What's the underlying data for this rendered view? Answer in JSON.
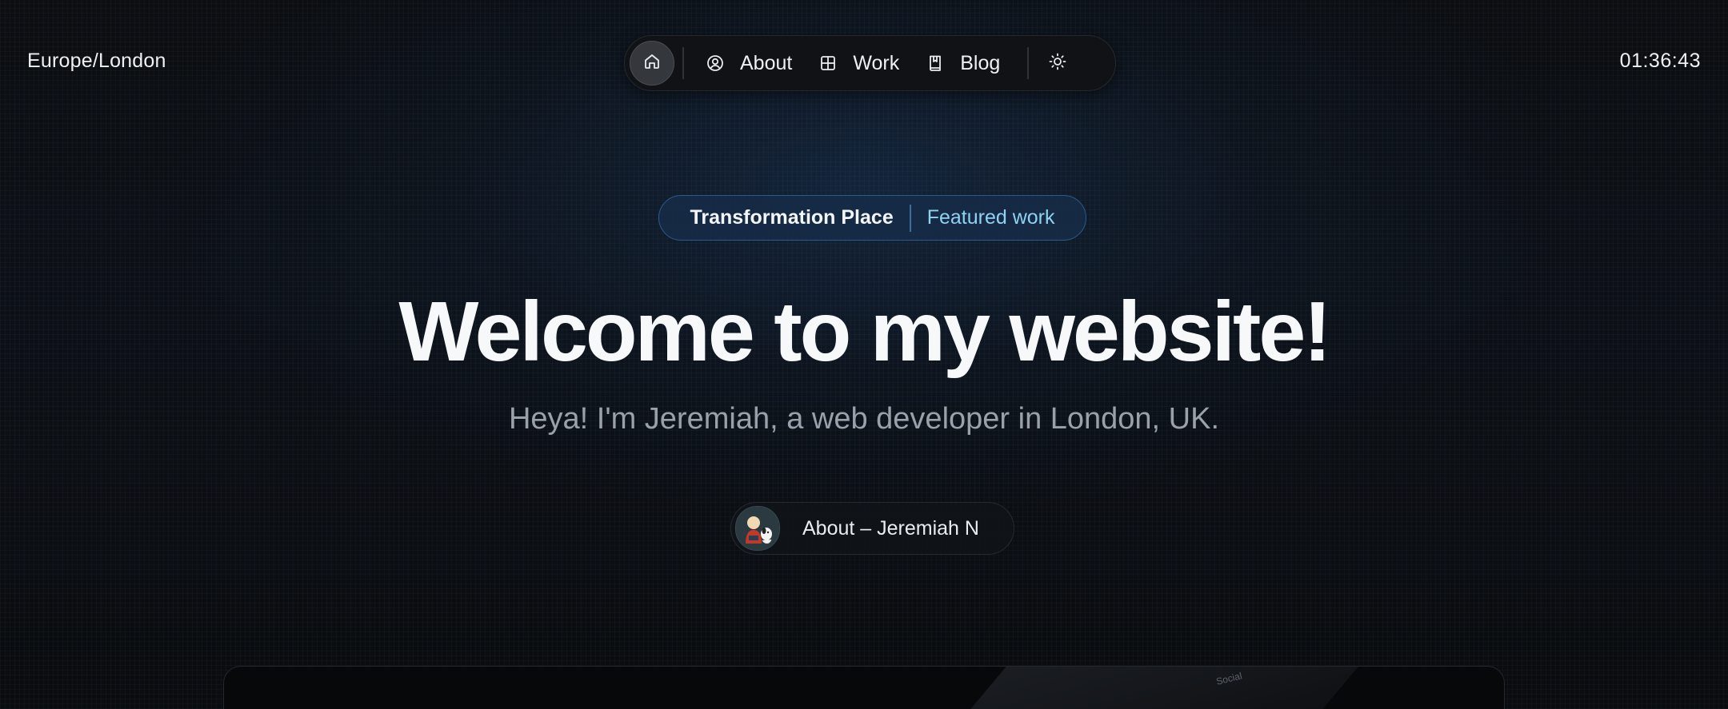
{
  "header": {
    "timezone": "Europe/London",
    "time": "01:36:43"
  },
  "nav": {
    "home_icon": "home-icon",
    "items": [
      {
        "label": "About",
        "icon": "user-circle-icon"
      },
      {
        "label": "Work",
        "icon": "grid-icon"
      },
      {
        "label": "Blog",
        "icon": "book-icon"
      }
    ],
    "theme_icon": "sun-icon"
  },
  "badge": {
    "title": "Transformation Place",
    "link": "Featured work"
  },
  "hero": {
    "title": "Welcome to my website!",
    "subtitle": "Heya! I'm Jeremiah, a web developer in London, UK."
  },
  "about_button": {
    "label": "About – Jeremiah N",
    "avatar": "avatar-image"
  },
  "preview": {
    "text": "Social"
  },
  "colors": {
    "background": "#0b0d10",
    "accent_link": "#8fd2f2",
    "badge_border": "#2c5a8a",
    "subtitle": "#9aa1aa"
  }
}
